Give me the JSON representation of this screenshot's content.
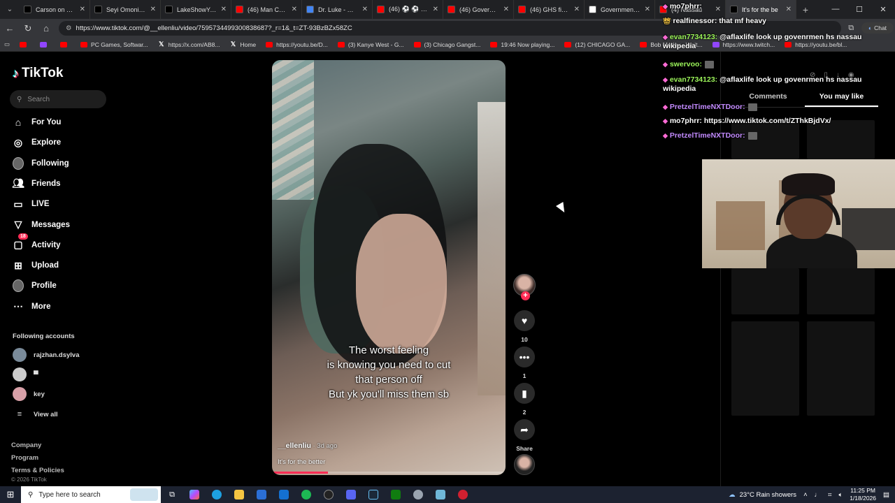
{
  "browser": {
    "tabs": [
      {
        "label": "Carson on X: \"ma",
        "icon": "x-logo-icon",
        "color": "#000000",
        "active": false
      },
      {
        "label": "Seyi Omonira on X",
        "icon": "x-logo-icon",
        "color": "#000000",
        "active": false
      },
      {
        "label": "LakeShowYo on X",
        "icon": "x-logo-icon",
        "color": "#000000",
        "active": false
      },
      {
        "label": "(46) Man Creating",
        "icon": "youtube-icon",
        "color": "#ff0000",
        "active": false
      },
      {
        "label": "Dr. Luke - Google",
        "icon": "google-icon",
        "color": "#4285f4",
        "active": false
      },
      {
        "label": "(46) ⚽ ⚽ - YouT",
        "icon": "youtube-icon",
        "color": "#ff0000",
        "active": false
      },
      {
        "label": "(46) Government",
        "icon": "youtube-icon",
        "color": "#ff0000",
        "active": false
      },
      {
        "label": "(46) GHS final - Y",
        "icon": "youtube-icon",
        "color": "#ff0000",
        "active": false
      },
      {
        "label": "Government High",
        "icon": "wikipedia-icon",
        "color": "#ffffff",
        "active": false
      },
      {
        "label": "(4) Nassau",
        "icon": "youtube-icon",
        "color": "#ff0000",
        "active": false
      },
      {
        "label": "It's for the be",
        "icon": "tiktok-icon",
        "color": "#000000",
        "active": true
      }
    ],
    "url": "https://www.tiktok.com/@__ellenliu/video/7595734499300838687?_r=1&_t=ZT-93BzBZx58ZC",
    "bookmarks": [
      {
        "label": "",
        "icon": "youtube-icon"
      },
      {
        "label": "",
        "icon": "twitch-icon"
      },
      {
        "label": "",
        "icon": "youtube-icon"
      },
      {
        "label": "PC Games, Softwar...",
        "icon": "youtube-icon"
      },
      {
        "label": "https://x.com/AB8...",
        "icon": "x-logo-icon"
      },
      {
        "label": "Home",
        "icon": "x-logo-icon"
      },
      {
        "label": "https://youtu.be/D...",
        "icon": "youtube-icon"
      },
      {
        "label": "(3) Kanye West - G...",
        "icon": "youtube-icon"
      },
      {
        "label": "(3) Chicago Gangst...",
        "icon": "youtube-icon"
      },
      {
        "label": "19:46 Now playing...",
        "icon": "youtube-icon"
      },
      {
        "label": "(12) CHICAGO GA...",
        "icon": "youtube-icon"
      },
      {
        "label": "Bob Marley - Wait...",
        "icon": "youtube-icon"
      },
      {
        "label": "https://www.twitch...",
        "icon": "twitch-icon"
      },
      {
        "label": "https://youtu.be/bl...",
        "icon": "youtube-icon"
      }
    ]
  },
  "tiktok": {
    "logo": "TikTok",
    "search_placeholder": "Search",
    "nav": [
      {
        "label": "For You",
        "icon": "home-icon"
      },
      {
        "label": "Explore",
        "icon": "compass-icon"
      },
      {
        "label": "Following",
        "icon": "following-avatar-icon"
      },
      {
        "label": "Friends",
        "icon": "friends-icon"
      },
      {
        "label": "LIVE",
        "icon": "live-icon"
      },
      {
        "label": "Messages",
        "icon": "messages-icon"
      },
      {
        "label": "Activity",
        "icon": "activity-icon",
        "badge": "18"
      },
      {
        "label": "Upload",
        "icon": "upload-icon"
      },
      {
        "label": "Profile",
        "icon": "profile-avatar-icon"
      },
      {
        "label": "More",
        "icon": "more-icon"
      }
    ],
    "following_title": "Following accounts",
    "following_accounts": [
      "rajzhan.dsylva",
      "▀",
      "key"
    ],
    "view_all": "View all",
    "footer_links": [
      "Company",
      "Program",
      "Terms & Policies"
    ],
    "copyright": "© 2026 TikTok",
    "video": {
      "caption_lines": [
        "The worst feeling",
        "is knowing you need to cut",
        "that person off",
        "But yk you'll miss them sb"
      ],
      "author": "__ellenliu",
      "time_ago": " · 3d ago",
      "description": "It's for the better",
      "progress": 0.24
    },
    "actions": {
      "likes": "10",
      "comments": "1",
      "bookmarks": "2",
      "share": "Share"
    },
    "panel_tabs": [
      "Comments",
      "You may like"
    ],
    "active_panel_tab": "You may like"
  },
  "stream_chat": [
    {
      "name": "mo7phrr:",
      "text": "",
      "color": "#ffffff"
    },
    {
      "name": "realfinessor:",
      "text": " that mf heavy",
      "color": "#ffffff"
    },
    {
      "name": "evan7734123:",
      "text": " @aflaxlife look up govenrmen hs nassau wikipedia",
      "color": "#9cf55a"
    },
    {
      "name": "swervoo:",
      "text": "",
      "color": "#9cf55a"
    },
    {
      "name": "evan7734123:",
      "text": " @aflaxlife look up govenrmen hs nassau wikipedia",
      "color": "#9cf55a"
    },
    {
      "name": "PretzelTimeNXTDoor:",
      "text": "",
      "color": "#c38bff"
    },
    {
      "name": "mo7phrr:",
      "text": " https://www.tiktok.com/t/ZThkBjdVx/",
      "color": "#ffffff"
    },
    {
      "name": "PretzelTimeNXTDoor:",
      "text": "",
      "color": "#c38bff"
    }
  ],
  "chat_button": "Chat",
  "taskbar": {
    "search_placeholder": "Type here to search",
    "weather": "23°C  Rain showers",
    "time": "11:25 PM",
    "date": "1/18/2026"
  },
  "colors": {
    "tiktok_red": "#fe2c55",
    "tiktok_cyan": "#25f4ee",
    "background": "#000000"
  }
}
